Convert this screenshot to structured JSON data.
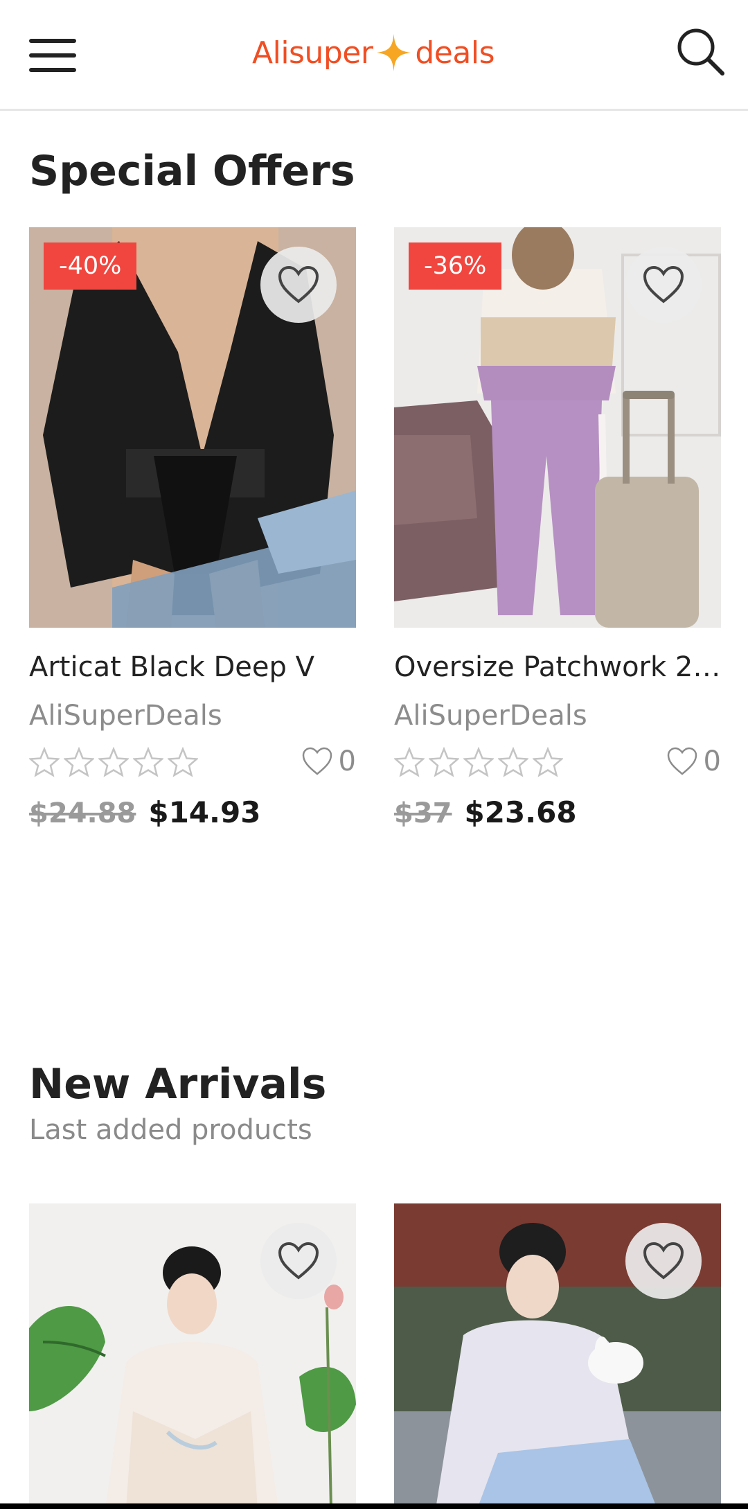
{
  "header": {
    "logo_left": "Alisuper",
    "logo_right": "deals",
    "brand_color": "#f04e23",
    "star_color": "#f6a623",
    "menu_icon": "hamburger-menu-icon",
    "search_icon": "search-icon"
  },
  "special_offers": {
    "title": "Special Offers",
    "products": [
      {
        "discount": "-40%",
        "title": "Articat Black Deep V",
        "seller": "AliSuperDeals",
        "rating": 0,
        "likes": "0",
        "old_price": "$24.88",
        "new_price": "$14.93",
        "image": "black deep v bodysuit photo"
      },
      {
        "discount": "-36%",
        "title": "Oversize Patchwork 2 ...",
        "seller": "AliSuperDeals",
        "rating": 0,
        "likes": "0",
        "old_price": "$37",
        "new_price": "$23.68",
        "image": "lilac patchwork tracksuit photo"
      }
    ]
  },
  "new_arrivals": {
    "title": "New Arrivals",
    "subtitle": "Last added products",
    "products": [
      {
        "image": "white hanfu with green leaves photo"
      },
      {
        "image": "white and blue hanfu with rabbit photo"
      }
    ]
  },
  "colors": {
    "discount_badge": "#f0463f",
    "muted_text": "#8c8c8c"
  }
}
